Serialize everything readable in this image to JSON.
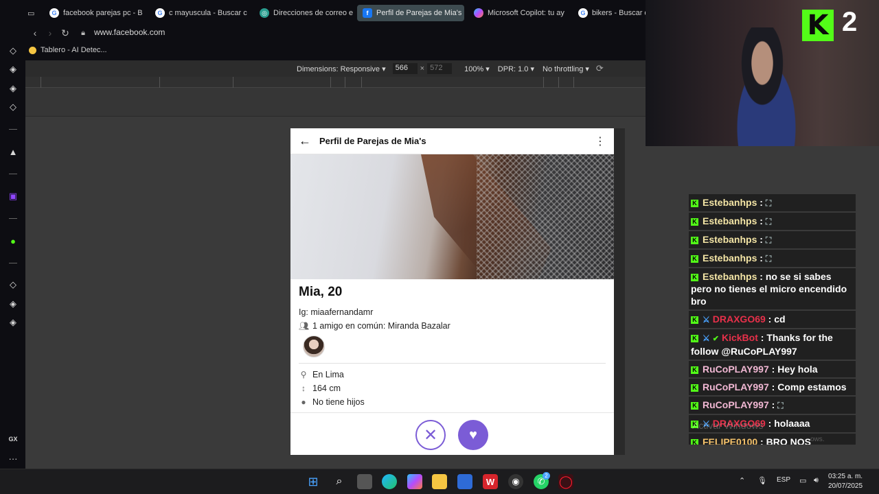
{
  "tabs": [
    {
      "label": "facebook parejas pc - B",
      "icon": "google-icon",
      "active": false
    },
    {
      "label": "c mayuscula - Buscar c",
      "icon": "google-icon",
      "active": false
    },
    {
      "label": "Direcciones de correo e",
      "icon": "openai-icon",
      "active": false
    },
    {
      "label": "Perfil de Parejas de Mia's",
      "icon": "facebook-icon",
      "active": true
    },
    {
      "label": "Microsoft Copilot: tu ay",
      "icon": "copilot-icon",
      "active": false
    },
    {
      "label": "bikers - Buscar c",
      "icon": "google-icon",
      "active": false
    }
  ],
  "address": {
    "url": "www.facebook.com"
  },
  "bookmarks": {
    "label": "Tablero - AI Detec..."
  },
  "devtools": {
    "dimensions": "Dimensions: Responsive ▾",
    "width": "566",
    "times": "×",
    "height": "572",
    "zoom": "100% ▾",
    "dpr": "DPR: 1.0 ▾",
    "throttle": "No throttling ▾"
  },
  "profile": {
    "header_title": "Perfil de Parejas de Mia's",
    "name": "Mia, 20",
    "instagram": "Ig: miaafernandamr",
    "mutual": "1 amigo en común: Miranda Bazalar",
    "location": "En Lima",
    "height": "164 cm",
    "children": "No tiene hijos"
  },
  "overlay": {
    "kick_letter": "K",
    "kick_number": "2"
  },
  "chat": [
    {
      "user": "Estebanhps",
      "text": "",
      "color": "#f5e6a6",
      "badges": [
        "k"
      ]
    },
    {
      "user": "Estebanhps",
      "text": "",
      "color": "#f5e6a6",
      "badges": [
        "k"
      ]
    },
    {
      "user": "Estebanhps",
      "text": "",
      "color": "#f5e6a6",
      "badges": [
        "k"
      ]
    },
    {
      "user": "Estebanhps",
      "text": "",
      "color": "#f5e6a6",
      "badges": [
        "k"
      ]
    },
    {
      "user": "Estebanhps",
      "text": "no se si sabes pero no tienes el micro encendido bro",
      "color": "#f5e6a6",
      "badges": [
        "k"
      ]
    },
    {
      "user": "DRAXGO69",
      "text": "cd",
      "color": "#e8304a",
      "badges": [
        "k",
        "sword"
      ]
    },
    {
      "user": "KickBot",
      "text": "Thanks for the follow @RuCoPLAY997",
      "color": "#e8304a",
      "badges": [
        "k",
        "sword",
        "check"
      ]
    },
    {
      "user": "RuCoPLAY997",
      "text": "Hey hola",
      "color": "#f2b8d4",
      "badges": [
        "k"
      ]
    },
    {
      "user": "RuCoPLAY997",
      "text": "Comp estamos",
      "color": "#f2b8d4",
      "badges": [
        "k"
      ]
    },
    {
      "user": "RuCoPLAY997",
      "text": "",
      "color": "#f2b8d4",
      "badges": [
        "k"
      ]
    },
    {
      "user": "DRAXGO69",
      "text": "holaaaa",
      "color": "#e8304a",
      "badges": [
        "k",
        "sword"
      ]
    },
    {
      "user": "FELIPE0100",
      "text": "BRO NOS APOYAMOS TE SIGO Y TU AMI",
      "color": "#f5c26b",
      "badges": [
        "k"
      ]
    }
  ],
  "watermark": {
    "line1": "Activar Windows",
    "line2": "ows."
  },
  "taskbar": {
    "lang": "ESP",
    "time": "03:25 a. m.",
    "date": "20/07/2025",
    "whatsapp_badge": "2"
  },
  "sidebar": {
    "gx_label": "GX",
    "more_label": "···"
  }
}
